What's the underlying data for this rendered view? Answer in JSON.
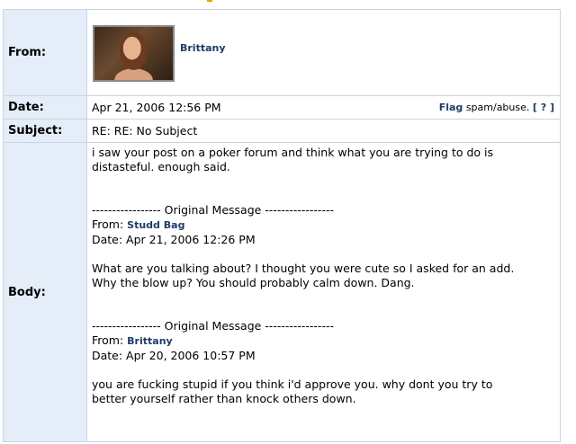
{
  "labels": {
    "from": "From:",
    "date": "Date:",
    "subject": "Subject:",
    "body": "Body:"
  },
  "message": {
    "from_name": "Brittany",
    "date": "Apr 21, 2006 12:56 PM",
    "subject": "RE: RE: No Subject",
    "flag_link": "Flag",
    "flag_text": "spam/abuse.",
    "help_link": "[ ? ]",
    "body": {
      "line1": "i saw your post on a poker forum and think what you are trying to do is",
      "line2": "distasteful. enough said.",
      "orig1": {
        "divider": "----------------- Original Message -----------------",
        "from_label": "From:",
        "from_name": "Studd Bag",
        "date": "Date: Apr 21, 2006 12:26 PM",
        "line1": "What are you talking about? I thought you were cute so I asked for an add.",
        "line2": "Why the blow up? You should probably calm down. Dang."
      },
      "orig2": {
        "divider": "----------------- Original Message -----------------",
        "from_label": "From:",
        "from_name": "Brittany",
        "date": "Date: Apr 20, 2006 10:57 PM",
        "line1": "you are fucking stupid if you think i'd approve you. why dont you try to",
        "line2": "better yourself rather than knock others down."
      }
    }
  },
  "colors": {
    "label_bg": "#e4edf8",
    "border": "#c6d6e6",
    "link": "#1f3c66"
  }
}
